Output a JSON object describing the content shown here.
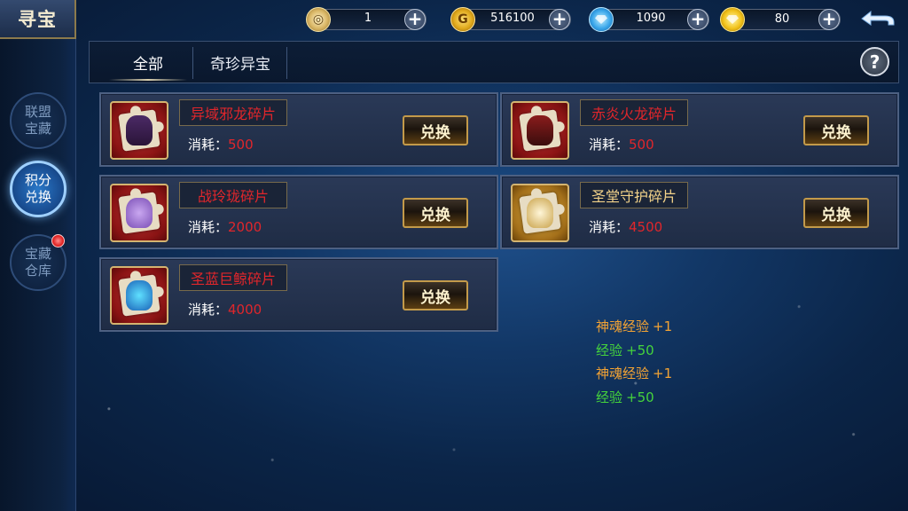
{
  "window_title": "寻宝",
  "sidebar": {
    "items": [
      {
        "label_line1": "联盟",
        "label_line2": "宝藏",
        "active": false
      },
      {
        "label_line1": "积分",
        "label_line2": "兑换",
        "active": true
      },
      {
        "label_line1": "宝藏",
        "label_line2": "仓库",
        "active": false,
        "badge": true
      }
    ]
  },
  "currencies": [
    {
      "icon": "silver-coin-icon",
      "value": "1"
    },
    {
      "icon": "gold-coin-icon",
      "value": "516100"
    },
    {
      "icon": "blue-diamond-icon",
      "value": "1090"
    },
    {
      "icon": "yellow-diamond-icon",
      "value": "80"
    }
  ],
  "tabs": [
    {
      "label": "全部",
      "active": true
    },
    {
      "label": "奇珍异宝",
      "active": false
    }
  ],
  "help_label": "?",
  "cost_label": "消耗：",
  "exchange_label": "兑换",
  "items": [
    {
      "name": "异域邪龙碎片",
      "name_color": "#e0262b",
      "cost": "500",
      "frame": "red"
    },
    {
      "name": "赤炎火龙碎片",
      "name_color": "#e0262b",
      "cost": "500",
      "frame": "red"
    },
    {
      "name": "战玲珑碎片",
      "name_color": "#e0262b",
      "cost": "2000",
      "frame": "red"
    },
    {
      "name": "圣堂守护碎片",
      "name_color": "#f3d38a",
      "cost": "4500",
      "frame": "gold"
    },
    {
      "name": "圣蓝巨鲸碎片",
      "name_color": "#e0262b",
      "cost": "4000",
      "frame": "red"
    }
  ],
  "log": [
    {
      "label": "神魂经验",
      "amount": "+1",
      "color": "orange"
    },
    {
      "label": "经验",
      "amount": "+50",
      "color": "green"
    },
    {
      "label": "神魂经验",
      "amount": "+1",
      "color": "orange"
    },
    {
      "label": "经验",
      "amount": "+50",
      "color": "green"
    }
  ]
}
